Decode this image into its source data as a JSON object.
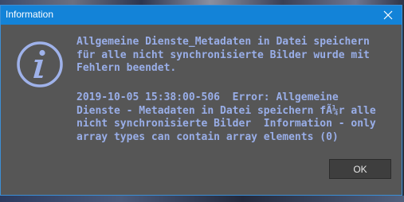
{
  "window": {
    "title": "Information",
    "close_icon": "close-icon"
  },
  "message": {
    "icon": "info-icon",
    "summary": "Allgemeine Dienste_Metadaten in Datei speichern\nfür alle nicht synchronisierte Bilder wurde mit\nFehlern beendet.",
    "detail": "2019-10-05 15:38:00-506  Error: Allgemeine\nDienste - Metadaten in Datei speichern fÃ¼r alle\nnicht synchronisierte Bilder  Information - only\narray types can contain array elements (0)"
  },
  "buttons": {
    "ok_label": "OK"
  },
  "colors": {
    "titlebar": "#1383d8",
    "dialog_bg": "#565656",
    "text": "#99aee8",
    "button_bg": "#3e3e3e"
  }
}
